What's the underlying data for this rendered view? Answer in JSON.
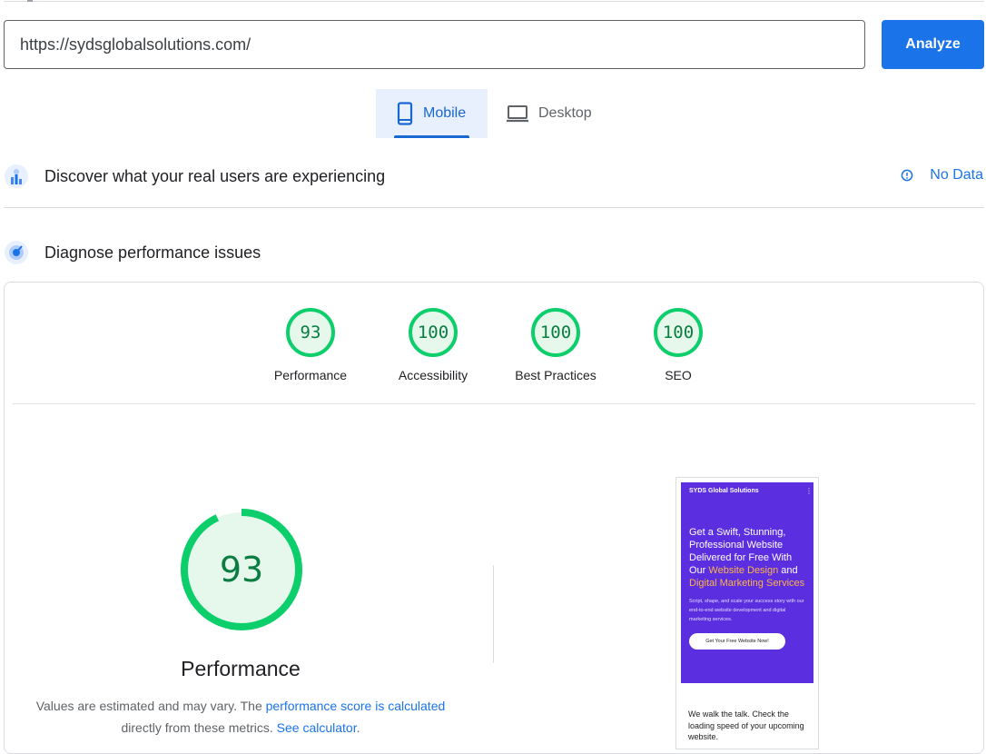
{
  "url_bar": {
    "value": "https://sydsglobalsolutions.com/",
    "analyze_label": "Analyze"
  },
  "device_tabs": [
    {
      "label": "Mobile",
      "icon": "smartphone-icon",
      "selected": true
    },
    {
      "label": "Desktop",
      "icon": "laptop-icon",
      "selected": false
    }
  ],
  "field_data": {
    "title": "Discover what your real users are experiencing",
    "status": "No Data"
  },
  "lab_data": {
    "title": "Diagnose performance issues"
  },
  "category_scores": [
    {
      "score": "93",
      "label": "Performance"
    },
    {
      "score": "100",
      "label": "Accessibility"
    },
    {
      "score": "100",
      "label": "Best Practices"
    },
    {
      "score": "100",
      "label": "SEO"
    }
  ],
  "performance": {
    "score": "93",
    "score_fraction": 0.93,
    "title": "Performance",
    "desc_prefix": "Values are estimated and may vary. The ",
    "desc_link1": "performance score is calculated",
    "desc_middle": " directly from these metrics. ",
    "desc_link2": "See calculator",
    "desc_suffix": "."
  },
  "screenshot": {
    "brand": "SYDS Global Solutions",
    "headline_main": "Get a Swift, Stunning, Professional Website Delivered for Free With Our ",
    "headline_hi1": "Website Design",
    "headline_and": " and ",
    "headline_hi2": "Digital Marketing Services",
    "subtext": "Script, shape, and scale your success story with our end-to-end website development and digital marketing services.",
    "cta": "Get Your Free Website Now!",
    "tagline": "We walk the talk. Check the loading speed of your upcoming website."
  },
  "colors": {
    "accent": "#1a73e8",
    "pass": "#0cce6b",
    "pass_text": "#0a7d41",
    "hero": "#5b2ee0"
  }
}
